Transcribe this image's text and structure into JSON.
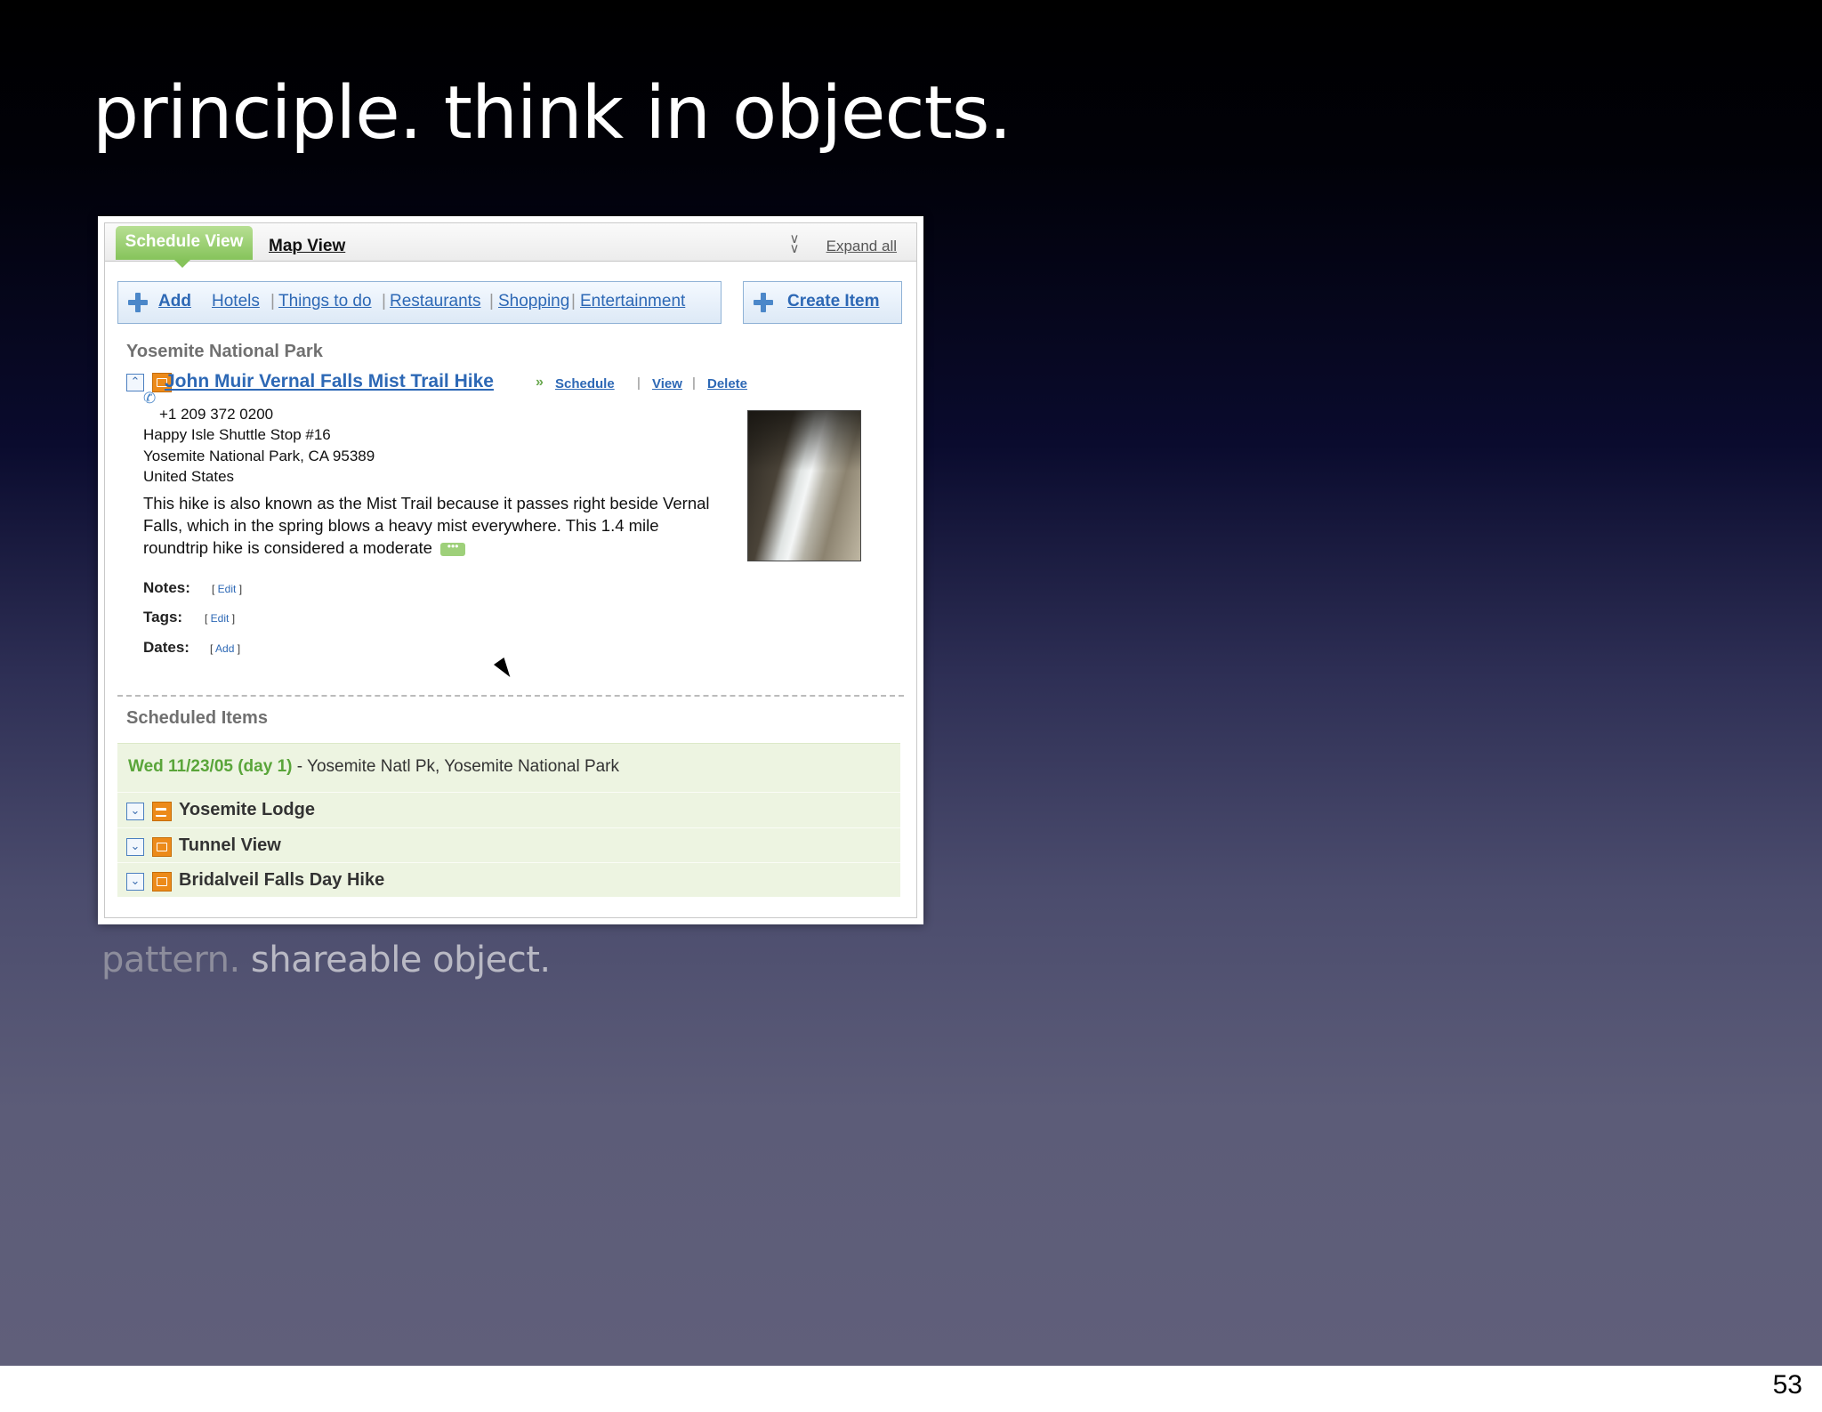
{
  "slide": {
    "title": "principle. think in objects.",
    "caption_prefix": "pattern.",
    "caption_emphasis": "shareable object.",
    "page_number": "53"
  },
  "screenshot": {
    "tabs": {
      "active": "Schedule View",
      "other": "Map View"
    },
    "expand_all": "Expand all",
    "add_bar": {
      "add_label": "Add",
      "categories": [
        "Hotels",
        "Things to do",
        "Restaurants",
        "Shopping",
        "Entertainment"
      ]
    },
    "create_item": "Create Item",
    "park": {
      "title": "Yosemite National Park",
      "item": {
        "title": "John Muir Vernal Falls Mist Trail Hike",
        "raquo": "»",
        "actions": [
          "Schedule",
          "View",
          "Delete"
        ],
        "separator": "|",
        "phone": "+1 209 372 0200",
        "address": [
          "Happy Isle Shuttle Stop #16",
          "Yosemite National Park, CA 95389",
          "United States"
        ],
        "description": "This hike is also known as the Mist Trail because it passes right beside Vernal Falls, which in the spring blows a heavy mist everywhere. This 1.4 mile roundtrip hike is considered a moderate",
        "more": "•••",
        "notes_label": "Notes:",
        "notes_action": "Edit",
        "tags_label": "Tags:",
        "tags_action": "Edit",
        "dates_label": "Dates:",
        "dates_action": "Add"
      }
    },
    "scheduled": {
      "title": "Scheduled Items",
      "date": "Wed 11/23/05 (day 1)",
      "location": "- Yosemite Natl Pk, Yosemite National Park",
      "items": [
        "Yosemite Lodge",
        "Tunnel View",
        "Bridalveil Falls Day Hike"
      ]
    }
  }
}
